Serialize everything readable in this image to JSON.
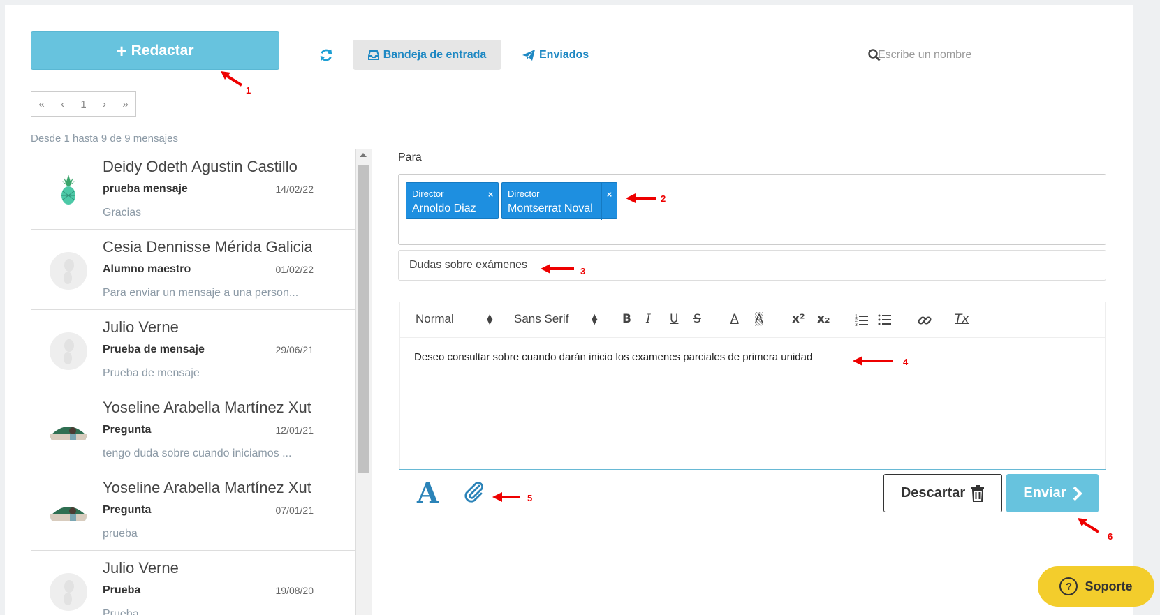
{
  "toolbar": {
    "compose_plus": "+",
    "compose_label": "Redactar",
    "inbox_label": "Bandeja de entrada",
    "sent_label": "Enviados",
    "search_placeholder": "Escribe un nombre"
  },
  "pagination": {
    "first": "«",
    "prev": "‹",
    "page": "1",
    "next": "›",
    "last": "»"
  },
  "message_count": "Desde 1 hasta 9 de 9 mensajes",
  "messages": [
    {
      "name": "Deidy Odeth Agustin Castillo",
      "subject": "prueba mensaje",
      "date": "14/02/22",
      "preview": "Gracias",
      "avatar": "pineapple"
    },
    {
      "name": "Cesia Dennisse Mérida Galicia",
      "subject": "Alumno maestro",
      "date": "01/02/22",
      "preview": "Para enviar un mensaje a una person...",
      "avatar": "default"
    },
    {
      "name": "Julio Verne",
      "subject": "Prueba de mensaje",
      "date": "29/06/21",
      "preview": "Prueba de mensaje",
      "avatar": "default"
    },
    {
      "name": "Yoseline Arabella Martínez Xutuc",
      "subject": "Pregunta",
      "date": "12/01/21",
      "preview": "tengo duda sobre cuando iniciamos ...",
      "avatar": "photo"
    },
    {
      "name": "Yoseline Arabella Martínez Xutuc",
      "subject": "Pregunta",
      "date": "07/01/21",
      "preview": "prueba",
      "avatar": "photo"
    },
    {
      "name": "Julio Verne",
      "subject": "Prueba",
      "date": "19/08/20",
      "preview": "Prueba",
      "avatar": "default"
    }
  ],
  "compose": {
    "to_label": "Para",
    "recipients": [
      {
        "role": "Director",
        "name": "Arnoldo Diaz",
        "remove": "×"
      },
      {
        "role": "Director",
        "name": "Montserrat Noval",
        "remove": "×"
      }
    ],
    "subject": "Dudas sobre exámenes",
    "editor": {
      "size": "Normal",
      "font": "Sans Serif",
      "bold": "B",
      "italic": "I",
      "underline": "U",
      "strike": "S",
      "color": "A",
      "superscript": "x²",
      "subscript": "x₂",
      "clean": "Tx",
      "body": "Deseo consultar sobre cuando darán inicio los examenes parciales de primera unidad"
    },
    "format_icon": "A",
    "discard_label": "Descartar",
    "send_label": "Enviar"
  },
  "support_label": "Soporte",
  "support_icon": "?",
  "annotations": [
    "1",
    "2",
    "3",
    "4",
    "5",
    "6"
  ],
  "colors": {
    "accent": "#67c3de",
    "chip": "#1e8fe0",
    "link": "#1e88c3",
    "annotation": "#e00000",
    "support": "#f3cd2c"
  }
}
